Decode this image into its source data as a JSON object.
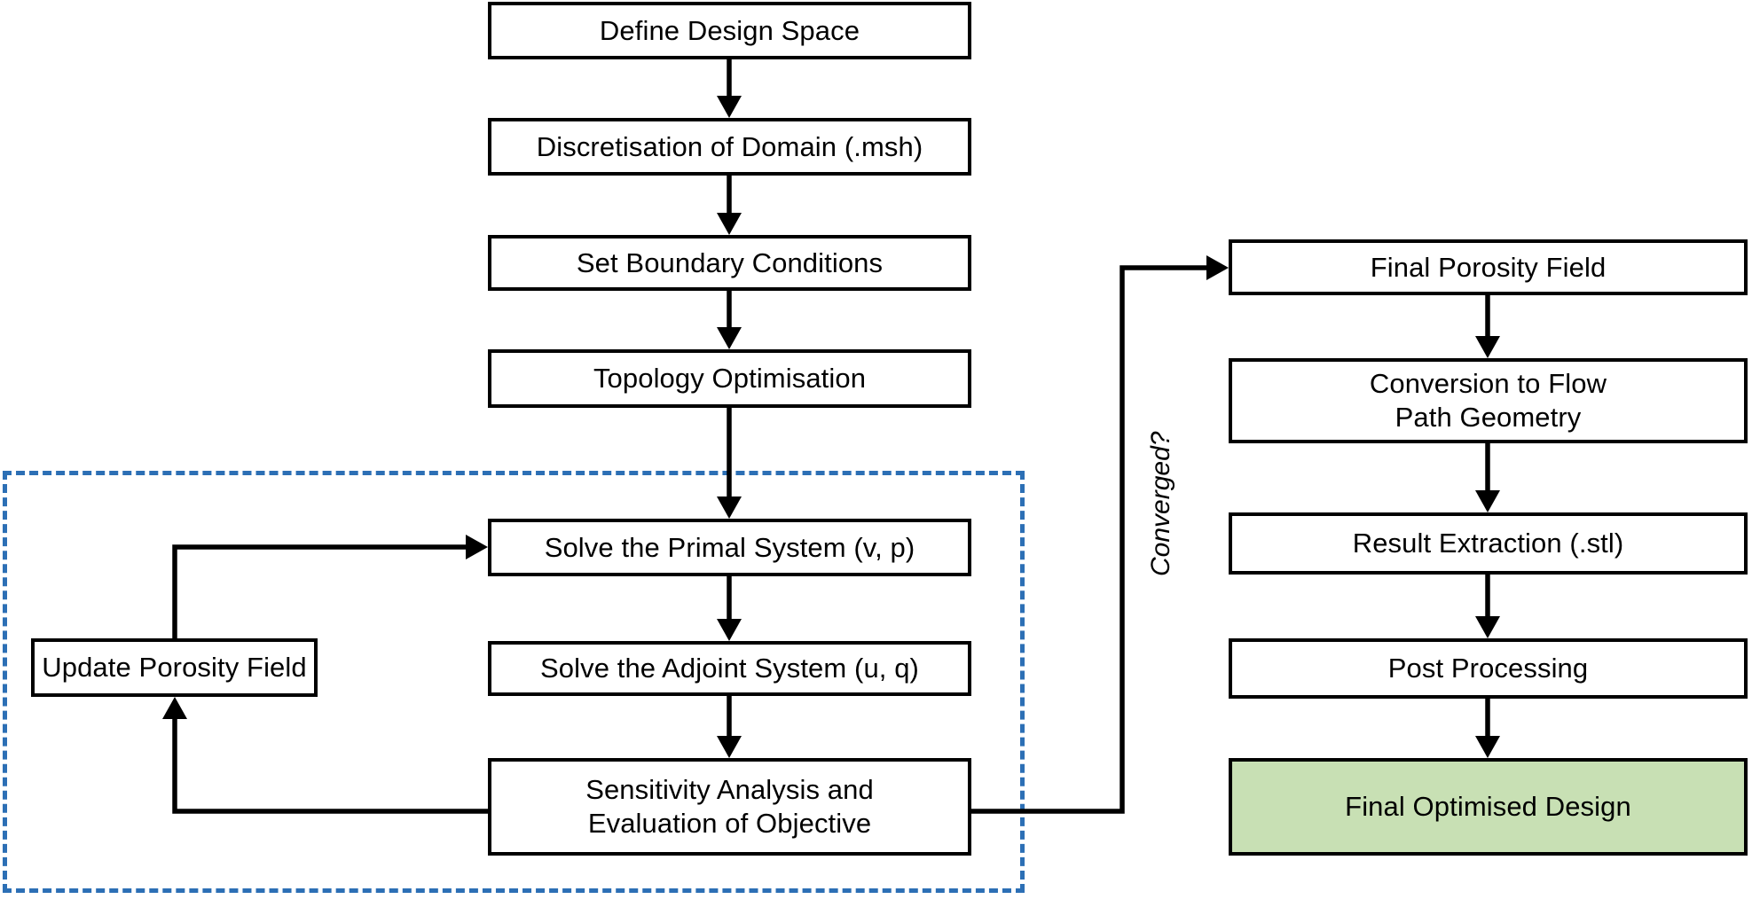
{
  "diagram": {
    "title": "Topology Optimisation Workflow Flowchart",
    "colors": {
      "box_border": "#000000",
      "box_fill": "#ffffff",
      "highlight_fill": "#c8e0b4",
      "dashed_region_border": "#2c6fb5",
      "edge": "#000000",
      "text": "#000000"
    },
    "nodes": [
      {
        "id": "define_design_space",
        "label": "Define Design Space"
      },
      {
        "id": "discretisation",
        "label": "Discretisation of Domain (.msh)"
      },
      {
        "id": "boundary_conditions",
        "label": "Set Boundary Conditions"
      },
      {
        "id": "topology_optimisation",
        "label": "Topology Optimisation"
      },
      {
        "id": "solve_primal",
        "label": "Solve the Primal System (v, p)"
      },
      {
        "id": "solve_adjoint",
        "label": "Solve the Adjoint System (u, q)"
      },
      {
        "id": "sensitivity",
        "label": "Sensitivity Analysis and\nEvaluation of Objective"
      },
      {
        "id": "update_porosity",
        "label": "Update Porosity Field"
      },
      {
        "id": "final_porosity",
        "label": "Final Porosity Field"
      },
      {
        "id": "conversion_flow_path",
        "label": "Conversion to Flow\nPath Geometry"
      },
      {
        "id": "result_extraction",
        "label": "Result Extraction (.stl)"
      },
      {
        "id": "post_processing",
        "label": "Post Processing"
      },
      {
        "id": "final_optimised",
        "label": "Final Optimised Design"
      }
    ],
    "edge_labels": {
      "converged": "Converged?"
    },
    "dashed_region": {
      "name": "iterative-optimisation-loop"
    }
  }
}
